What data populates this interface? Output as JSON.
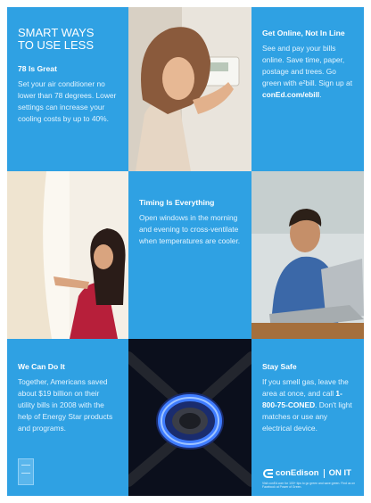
{
  "panels": {
    "smart_ways": {
      "title_line1": "SMART WAYS",
      "title_line2": "TO USE LESS",
      "heading": "78 Is Great",
      "body": "Set your air conditioner no lower than 78 degrees. Lower settings can increase your cooling costs by up to 40%."
    },
    "get_online": {
      "heading": "Get Online, Not In Line",
      "body_prefix": "See and pay your bills online. Save time, paper, postage and trees. Go green with e²bill. Sign up at",
      "link": "conEd.com/ebill",
      "suffix": "."
    },
    "timing": {
      "heading": "Timing Is Everything",
      "body": "Open windows in the morning and evening to cross-ventilate when temperatures are cooler."
    },
    "we_can_do_it": {
      "heading": "We Can Do It",
      "body": "Together, Americans saved about $19 billion on their utility bills in 2008 with the help of Energy Star products and programs."
    },
    "stay_safe": {
      "heading": "Stay Safe",
      "body_prefix": "If you smell gas, leave the area at once, and call",
      "phone": "1-800-75-CONED",
      "body_suffix": ". Don't light matches or use any electrical device."
    }
  },
  "brand": {
    "logo_text": "conEdison",
    "tagline": "ON IT",
    "fine_print": "Visit conEd.com for 100+ tips to go green and save green. Find us on Facebook at Power of Green."
  },
  "colors": {
    "panel_blue": "#2fa1e3",
    "text_white": "#ffffff"
  },
  "photos": {
    "top_middle": "woman-adjusting-thermostat",
    "middle_left": "woman-opening-curtains",
    "middle_right": "man-using-laptop",
    "bottom_middle": "gas-stove-burner-flame"
  }
}
